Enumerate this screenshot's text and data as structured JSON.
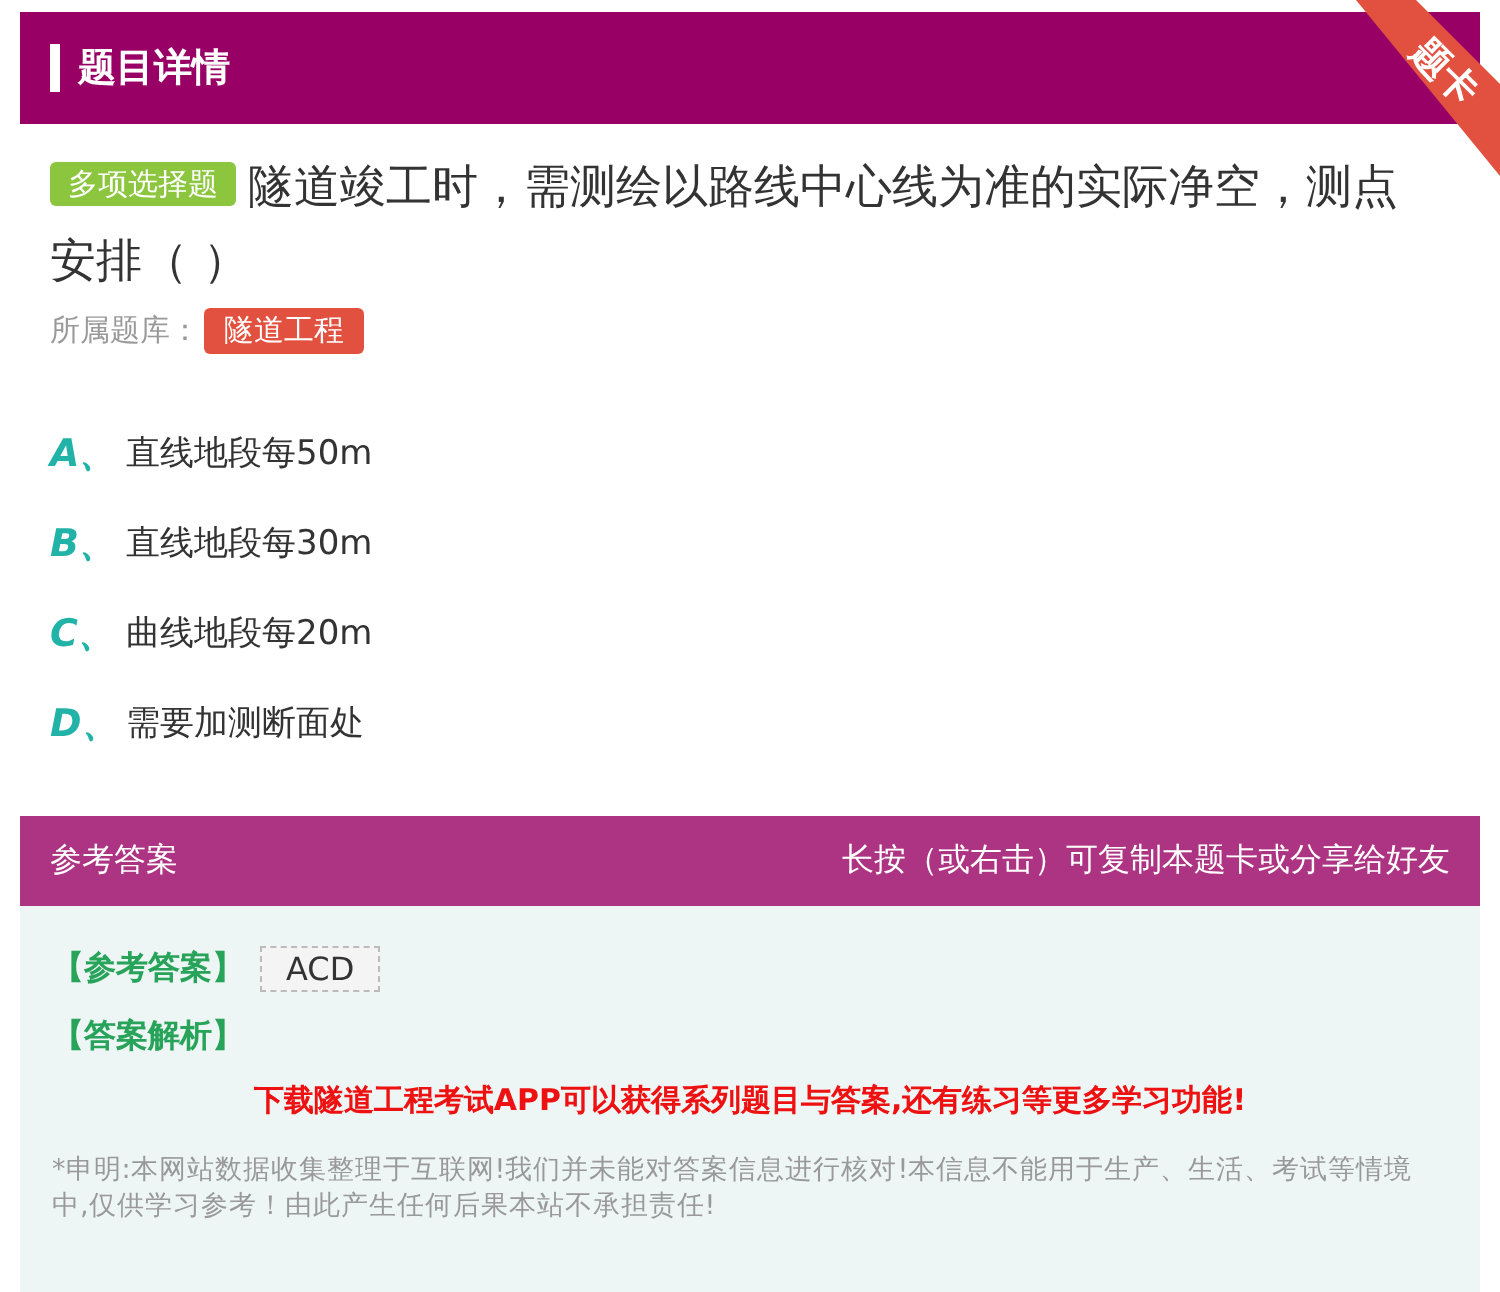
{
  "header": {
    "title": "题目详情",
    "ribbon": "题卡"
  },
  "question": {
    "type_tag": "多项选择题",
    "text": "隧道竣工时，需测绘以路线中心线为准的实际净空，测点安排（ ）",
    "bank_label": "所属题库：",
    "bank_tag": "隧道工程"
  },
  "options": [
    {
      "letter": "A、",
      "text": "直线地段每50m"
    },
    {
      "letter": "B、",
      "text": "直线地段每30m"
    },
    {
      "letter": "C、",
      "text": "曲线地段每20m"
    },
    {
      "letter": "D、",
      "text": "需要加测断面处"
    }
  ],
  "answer_bar": {
    "title": "参考答案",
    "hint": "长按（或右击）可复制本题卡或分享给好友"
  },
  "answer": {
    "answer_label": "【参考答案】",
    "answer_value": "ACD",
    "analysis_label": "【答案解析】",
    "promo": "下载隧道工程考试APP可以获得系列题目与答案,还有练习等更多学习功能!",
    "disclaimer": "*申明:本网站数据收集整理于互联网!我们并未能对答案信息进行核对!本信息不能用于生产、生活、考试等情境中,仅供学习参考！由此产生任何后果本站不承担责任!"
  }
}
